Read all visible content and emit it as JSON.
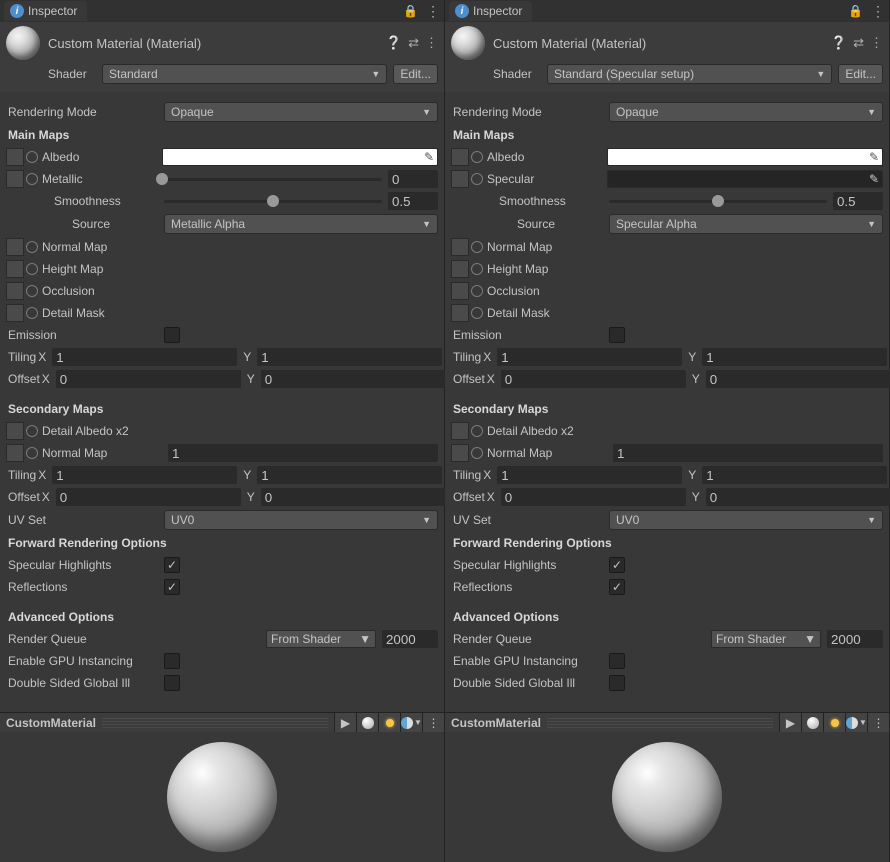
{
  "panels": [
    {
      "tab": "Inspector",
      "material_title": "Custom Material (Material)",
      "shader_label": "Shader",
      "shader_value": "Standard",
      "edit_btn": "Edit...",
      "rendering_mode_label": "Rendering Mode",
      "rendering_mode_value": "Opaque",
      "main_maps_header": "Main Maps",
      "albedo_label": "Albedo",
      "workflow_label": "Metallic",
      "workflow_is_slider": true,
      "workflow_value": "0",
      "workflow_slider_pct": 0,
      "smoothness_label": "Smoothness",
      "smoothness_value": "0.5",
      "smoothness_slider_pct": 50,
      "source_label": "Source",
      "source_value": "Metallic Alpha",
      "normal_label": "Normal Map",
      "height_label": "Height Map",
      "occlusion_label": "Occlusion",
      "detailmask_label": "Detail Mask",
      "emission_label": "Emission",
      "tiling_label": "Tiling",
      "tiling_x": "1",
      "tiling_y": "1",
      "offset_label": "Offset",
      "offset_x": "0",
      "offset_y": "0",
      "secondary_header": "Secondary Maps",
      "detail_albedo_label": "Detail Albedo x2",
      "sec_normal_label": "Normal Map",
      "sec_normal_value": "1",
      "sec_tiling_label": "Tiling",
      "sec_tiling_x": "1",
      "sec_tiling_y": "1",
      "sec_offset_label": "Offset",
      "sec_offset_x": "0",
      "sec_offset_y": "0",
      "uvset_label": "UV Set",
      "uvset_value": "UV0",
      "fwd_header": "Forward Rendering Options",
      "spec_hl_label": "Specular Highlights",
      "refl_label": "Reflections",
      "adv_header": "Advanced Options",
      "renderq_label": "Render Queue",
      "renderq_dd": "From Shader",
      "renderq_num": "2000",
      "gpu_label": "Enable GPU Instancing",
      "dsgi_label": "Double Sided Global Ill",
      "preview_name": "CustomMaterial"
    },
    {
      "tab": "Inspector",
      "material_title": "Custom Material (Material)",
      "shader_label": "Shader",
      "shader_value": "Standard (Specular setup)",
      "edit_btn": "Edit...",
      "rendering_mode_label": "Rendering Mode",
      "rendering_mode_value": "Opaque",
      "main_maps_header": "Main Maps",
      "albedo_label": "Albedo",
      "workflow_label": "Specular",
      "workflow_is_slider": false,
      "smoothness_label": "Smoothness",
      "smoothness_value": "0.5",
      "smoothness_slider_pct": 50,
      "source_label": "Source",
      "source_value": "Specular Alpha",
      "normal_label": "Normal Map",
      "height_label": "Height Map",
      "occlusion_label": "Occlusion",
      "detailmask_label": "Detail Mask",
      "emission_label": "Emission",
      "tiling_label": "Tiling",
      "tiling_x": "1",
      "tiling_y": "1",
      "offset_label": "Offset",
      "offset_x": "0",
      "offset_y": "0",
      "secondary_header": "Secondary Maps",
      "detail_albedo_label": "Detail Albedo x2",
      "sec_normal_label": "Normal Map",
      "sec_normal_value": "1",
      "sec_tiling_label": "Tiling",
      "sec_tiling_x": "1",
      "sec_tiling_y": "1",
      "sec_offset_label": "Offset",
      "sec_offset_x": "0",
      "sec_offset_y": "0",
      "uvset_label": "UV Set",
      "uvset_value": "UV0",
      "fwd_header": "Forward Rendering Options",
      "spec_hl_label": "Specular Highlights",
      "refl_label": "Reflections",
      "adv_header": "Advanced Options",
      "renderq_label": "Render Queue",
      "renderq_dd": "From Shader",
      "renderq_num": "2000",
      "gpu_label": "Enable GPU Instancing",
      "dsgi_label": "Double Sided Global Ill",
      "preview_name": "CustomMaterial"
    }
  ],
  "axis_x": "X",
  "axis_y": "Y"
}
